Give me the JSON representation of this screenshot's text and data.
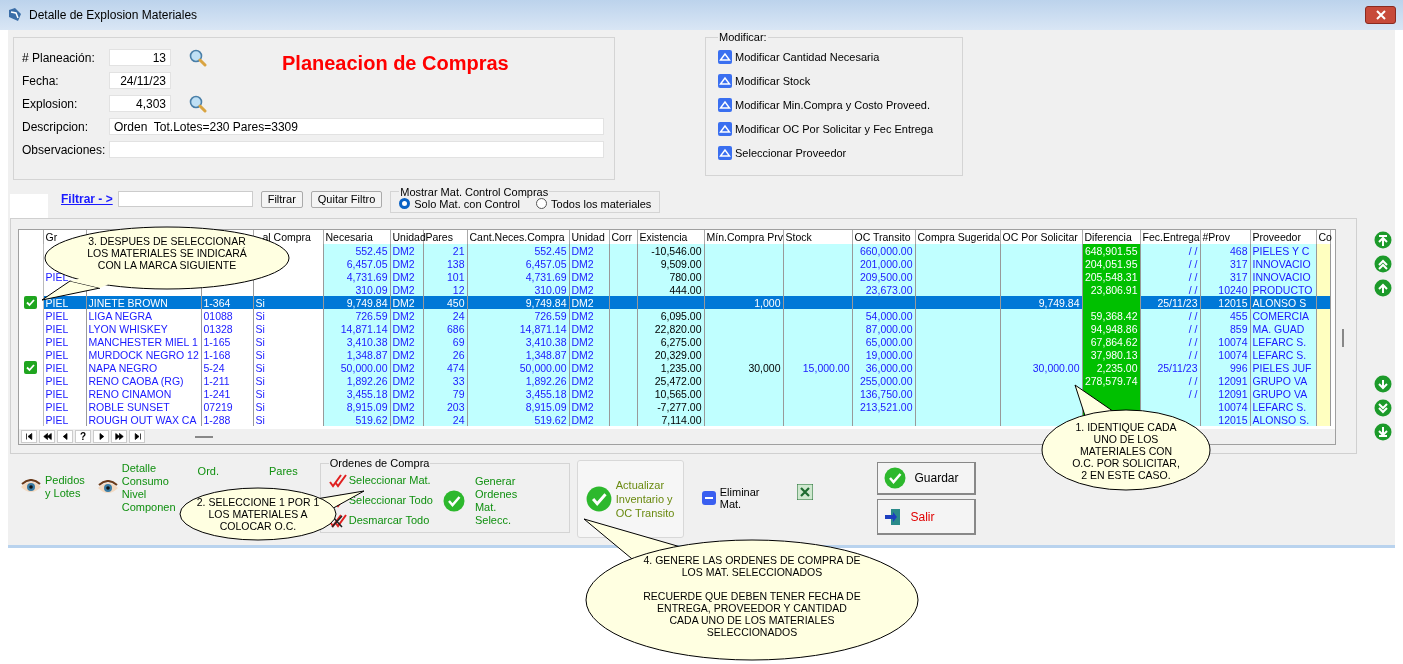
{
  "window": {
    "title": "Detalle de Explosion Materiales"
  },
  "header": {
    "fields": [
      {
        "label": "# Planeación:",
        "value": "13",
        "kind": "short",
        "search": true
      },
      {
        "label": "Fecha:",
        "value": "24/11/23",
        "kind": "short",
        "search": false
      },
      {
        "label": "Explosion:",
        "value": "4,303",
        "kind": "short",
        "search": true
      },
      {
        "label": "Descripcion:",
        "value": "Orden  Tot.Lotes=230 Pares=3309",
        "kind": "long",
        "search": false
      },
      {
        "label": "Observaciones:",
        "kind": "long",
        "search": false
      }
    ],
    "heading": "Planeacion de Compras"
  },
  "modify_group": {
    "title": "Modificar:",
    "actions": [
      "Modificar Cantidad Necesaria",
      "Modificar Stock",
      "Modificar Min.Compra y Costo Proveed.",
      "Modificar OC Por Solicitar y Fec Entrega",
      "Seleccionar Proveedor"
    ]
  },
  "filter": {
    "link": "Filtrar - >",
    "buttons": [
      "Filtrar",
      "Quitar Filtro"
    ]
  },
  "show_group": {
    "title": "Mostrar Mat. Control Compras",
    "options": [
      {
        "label": "Solo Mat. con Control",
        "selected": true
      },
      {
        "label": "Todos los materiales",
        "selected": false
      }
    ]
  },
  "table": {
    "columns": [
      "Gr",
      null,
      null,
      "al Compra",
      "Necesaria",
      "Unidad",
      "Pares",
      "Cant.Neces.Compra",
      "Unidad",
      "Corr",
      "Existencia",
      "Mín.Compra Prv",
      "Stock",
      "OC Transito",
      "Compra Sugerida",
      "OC Por Solicitar",
      "Diferencia",
      "Fec.Entrega",
      "#Prov",
      "Proveedor",
      "Co"
    ],
    "rows": [
      {
        "checked": false,
        "selected": false,
        "cells": [
          null,
          null,
          null,
          null,
          "552.45",
          "DM2",
          "21",
          "552.45",
          "DM2",
          null,
          "-10,546.00",
          null,
          null,
          "660,000.00",
          null,
          null,
          "648,901.55",
          "/ /",
          "468",
          "PIELES Y C",
          null
        ]
      },
      {
        "checked": false,
        "selected": false,
        "cells": [
          null,
          null,
          null,
          null,
          "6,457.05",
          "DM2",
          "138",
          "6,457.05",
          "DM2",
          null,
          "9,509.00",
          null,
          null,
          "201,000.00",
          null,
          null,
          "204,051.95",
          "/ /",
          "317",
          "INNOVACIO",
          null
        ]
      },
      {
        "checked": false,
        "selected": false,
        "cells": [
          "PIEL",
          null,
          null,
          null,
          "4,731.69",
          "DM2",
          "101",
          "4,731.69",
          "DM2",
          null,
          "780.00",
          null,
          null,
          "209,500.00",
          null,
          null,
          "205,548.31",
          "/ /",
          "317",
          "INNOVACIO",
          null
        ]
      },
      {
        "checked": false,
        "selected": false,
        "cells": [
          null,
          null,
          null,
          null,
          "310.09",
          "DM2",
          "12",
          "310.09",
          "DM2",
          null,
          "444.00",
          null,
          null,
          "23,673.00",
          null,
          null,
          "23,806.91",
          "/ /",
          "10240",
          "PRODUCTO",
          null
        ]
      },
      {
        "checked": true,
        "selected": true,
        "cells": [
          "PIEL",
          "JINETE BROWN",
          "1-364",
          "Si",
          "9,749.84",
          "DM2",
          "450",
          "9,749.84",
          "DM2",
          null,
          null,
          "1,000",
          null,
          null,
          null,
          "9,749.84",
          null,
          "25/11/23",
          "12015",
          "ALONSO S",
          null
        ]
      },
      {
        "checked": false,
        "selected": false,
        "cells": [
          "PIEL",
          "LIGA NEGRA",
          "01088",
          "Si",
          "726.59",
          "DM2",
          "24",
          "726.59",
          "DM2",
          null,
          "6,095.00",
          null,
          null,
          "54,000.00",
          null,
          null,
          "59,368.42",
          "/ /",
          "455",
          "COMERCIA",
          null
        ]
      },
      {
        "checked": false,
        "selected": false,
        "cells": [
          "PIEL",
          "LYON WHISKEY",
          "01328",
          "Si",
          "14,871.14",
          "DM2",
          "686",
          "14,871.14",
          "DM2",
          null,
          "22,820.00",
          null,
          null,
          "87,000.00",
          null,
          null,
          "94,948.86",
          "/ /",
          "859",
          "MA. GUAD",
          null
        ]
      },
      {
        "checked": false,
        "selected": false,
        "cells": [
          "PIEL",
          "MANCHESTER MIEL 1",
          "1-165",
          "Si",
          "3,410.38",
          "DM2",
          "69",
          "3,410.38",
          "DM2",
          null,
          "6,275.00",
          null,
          null,
          "65,000.00",
          null,
          null,
          "67,864.62",
          "/ /",
          "10074",
          "LEFARC S.",
          null
        ]
      },
      {
        "checked": false,
        "selected": false,
        "cells": [
          "PIEL",
          "MURDOCK NEGRO 12",
          "1-168",
          "Si",
          "1,348.87",
          "DM2",
          "26",
          "1,348.87",
          "DM2",
          null,
          "20,329.00",
          null,
          null,
          "19,000.00",
          null,
          null,
          "37,980.13",
          "/ /",
          "10074",
          "LEFARC S.",
          null
        ]
      },
      {
        "checked": true,
        "selected": false,
        "cells": [
          "PIEL",
          "NAPA NEGRO",
          "5-24",
          "Si",
          "50,000.00",
          "DM2",
          "474",
          "50,000.00",
          "DM2",
          null,
          "1,235.00",
          "30,000",
          "15,000.00",
          "36,000.00",
          null,
          "30,000.00",
          "2,235.00",
          "25/11/23",
          "996",
          "PIELES JUF",
          null
        ]
      },
      {
        "checked": false,
        "selected": false,
        "cells": [
          "PIEL",
          "RENO CAOBA (RG)",
          "1-211",
          "Si",
          "1,892.26",
          "DM2",
          "33",
          "1,892.26",
          "DM2",
          null,
          "25,472.00",
          null,
          null,
          "255,000.00",
          null,
          null,
          "278,579.74",
          "/ /",
          "12091",
          "GRUPO VA",
          null
        ]
      },
      {
        "checked": false,
        "selected": false,
        "cells": [
          "PIEL",
          "RENO CINAMON",
          "1-241",
          "Si",
          "3,455.18",
          "DM2",
          "79",
          "3,455.18",
          "DM2",
          null,
          "10,565.00",
          null,
          null,
          "136,750.00",
          null,
          null,
          null,
          "/ /",
          "12091",
          "GRUPO VA",
          null
        ]
      },
      {
        "checked": false,
        "selected": false,
        "cells": [
          "PIEL",
          "ROBLE SUNSET",
          "07219",
          "Si",
          "8,915.09",
          "DM2",
          "203",
          "8,915.09",
          "DM2",
          null,
          "-7,277.00",
          null,
          null,
          "213,521.00",
          null,
          null,
          null,
          null,
          "10074",
          "LEFARC S.",
          null
        ]
      },
      {
        "checked": false,
        "selected": false,
        "cells": [
          "PIEL",
          "ROUGH OUT WAX CA",
          "1-288",
          "Si",
          "519.62",
          "DM2",
          "24",
          "519.62",
          "DM2",
          null,
          "7,114.00",
          null,
          null,
          null,
          null,
          null,
          null,
          null,
          "12015",
          "ALONSO S.",
          null
        ]
      }
    ],
    "nav": [
      {
        "kind": "first"
      },
      {
        "kind": "prev-page"
      },
      {
        "kind": "prev"
      },
      {
        "kind": "help",
        "label": "?"
      },
      {
        "kind": "next"
      },
      {
        "kind": "next-page"
      },
      {
        "kind": "last"
      }
    ]
  },
  "bottom": {
    "links": [
      "Pedidos\ny Lotes",
      "Detalle\nConsumo\nNivel\nComponen"
    ],
    "ord": "Ord.",
    "pares": "Pares",
    "orders_group": {
      "title": "Ordenes de Compra",
      "actions": [
        {
          "label": "Seleccionar Mat.",
          "kind": "check"
        },
        {
          "label": "Seleccionar Todo",
          "kind": "check"
        },
        {
          "label": "Desmarcar Todo",
          "kind": "uncheck"
        }
      ],
      "generate": "Generar\nOrdenes\nMat.\nSelecc."
    },
    "update": "Actualizar\nInventario y\nOC Transito",
    "delete": "Eliminar\nMat.",
    "save": "Guardar",
    "exit": "Salir"
  },
  "callouts": [
    "3. DESPUES DE SELECCIONAR\nLOS MATERIALES SE INDICARÁ\nCON LA MARCA SIGUIENTE",
    "1. IDENTIQUE CADA\nUNO DE LOS\nMATERIALES CON\nO.C. POR SOLICITAR,\n2 EN ESTE CASO.",
    "2. SELECCIONE 1 POR 1\nLOS MATERIALES A\nCOLOCAR O.C.",
    "4. GENERE LAS ORDENES DE COMPRA DE\nLOS MAT. SELECCIONADOS\n\nRECUERDE QUE DEBEN TENER FECHA DE\nENTREGA, PROVEEDOR Y CANTIDAD\nCADA UNO DE LOS MATERIALES\nSELECCIONADOS"
  ]
}
